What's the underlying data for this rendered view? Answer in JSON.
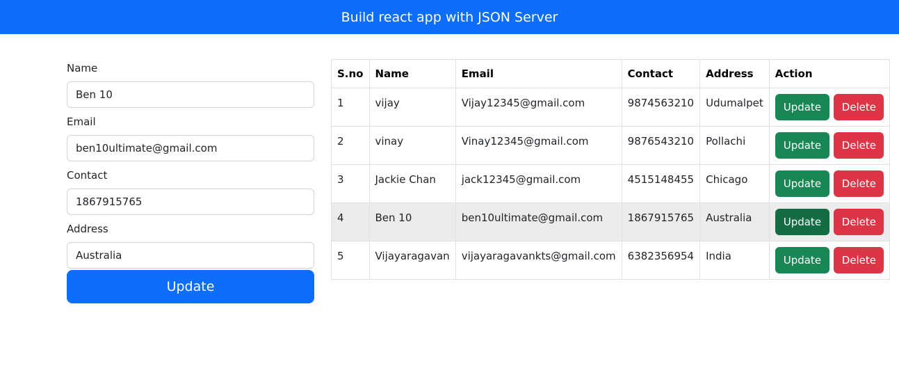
{
  "header": {
    "title": "Build react app with JSON Server"
  },
  "form": {
    "name_label": "Name",
    "name_value": "Ben 10",
    "email_label": "Email",
    "email_value": "ben10ultimate@gmail.com",
    "contact_label": "Contact",
    "contact_value": "1867915765",
    "address_label": "Address",
    "address_value": "Australia",
    "submit_label": "Update"
  },
  "table": {
    "headers": [
      "S.no",
      "Name",
      "Email",
      "Contact",
      "Address",
      "Action"
    ],
    "update_label": "Update",
    "delete_label": "Delete",
    "highlighted_row": 3,
    "rows": [
      {
        "sno": "1",
        "name": "vijay",
        "email": "Vijay12345@gmail.com",
        "contact": "9874563210",
        "address": "Udumalpet"
      },
      {
        "sno": "2",
        "name": "vinay",
        "email": "Vinay12345@gmail.com",
        "contact": "9876543210",
        "address": "Pollachi"
      },
      {
        "sno": "3",
        "name": "Jackie Chan",
        "email": "jack12345@gmail.com",
        "contact": "4515148455",
        "address": "Chicago"
      },
      {
        "sno": "4",
        "name": "Ben 10",
        "email": "ben10ultimate@gmail.com",
        "contact": "1867915765",
        "address": "Australia"
      },
      {
        "sno": "5",
        "name": "Vijayaragavan",
        "email": "vijayaragavankts@gmail.com",
        "contact": "6382356954",
        "address": "India"
      }
    ]
  },
  "colors": {
    "primary": "#0d6efd",
    "success": "#198754",
    "danger": "#dc3545",
    "highlight_row": "#ececec"
  }
}
